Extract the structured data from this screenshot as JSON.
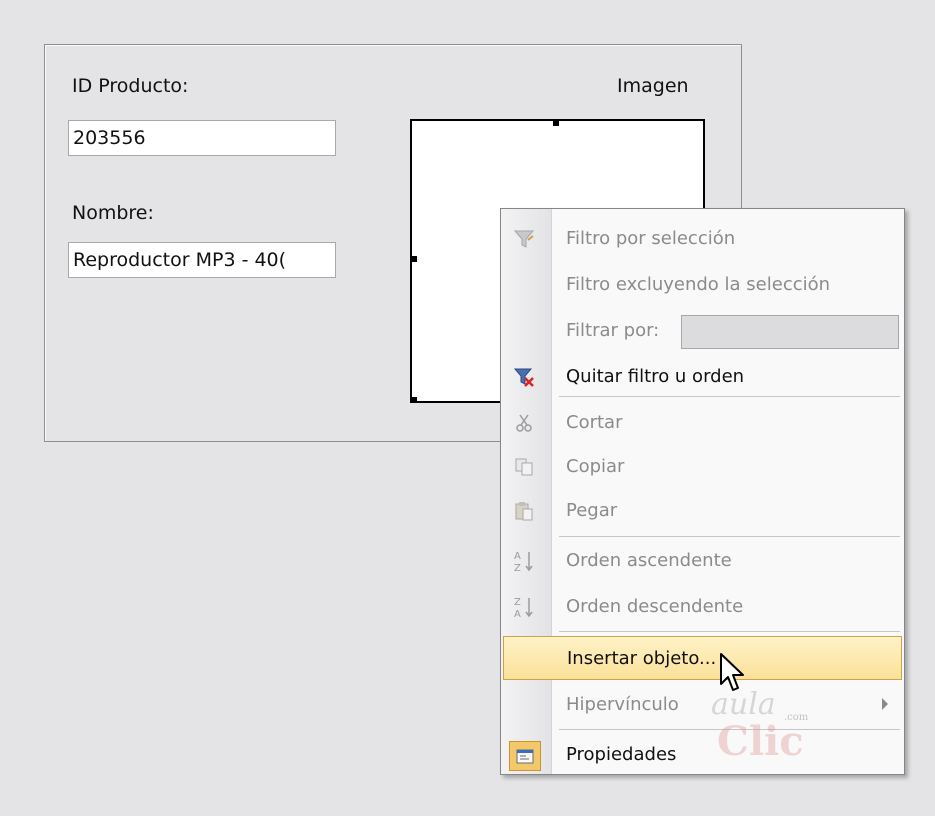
{
  "form": {
    "id_label": "ID Producto:",
    "id_value": "203556",
    "name_label": "Nombre:",
    "name_value": "Reproductor MP3 - 40(",
    "image_label": "Imagen"
  },
  "context_menu": {
    "items": [
      {
        "label": "Filtro por selección",
        "enabled": false,
        "icon": "filter-selection-icon"
      },
      {
        "label": "Filtro excluyendo la selección",
        "enabled": false,
        "icon": ""
      },
      {
        "label": "Filtrar por:",
        "enabled": false,
        "icon": "",
        "input_value": ""
      },
      {
        "label": "Quitar filtro u orden",
        "enabled": true,
        "icon": "remove-filter-icon"
      },
      {
        "label": "Cortar",
        "enabled": false,
        "icon": "scissors-icon"
      },
      {
        "label": "Copiar",
        "enabled": false,
        "icon": "copy-icon"
      },
      {
        "label": "Pegar",
        "enabled": false,
        "icon": "paste-icon"
      },
      {
        "label": "Orden ascendente",
        "enabled": false,
        "icon": "sort-ascending-icon"
      },
      {
        "label": "Orden descendente",
        "enabled": false,
        "icon": "sort-descending-icon"
      },
      {
        "label": "Insertar objeto...",
        "enabled": true,
        "highlighted": true,
        "icon": ""
      },
      {
        "label": "Hipervínculo",
        "enabled": false,
        "icon": "",
        "submenu": true
      },
      {
        "label": "Propiedades",
        "enabled": true,
        "icon": "properties-icon"
      }
    ]
  },
  "watermark": {
    "line1": "aula",
    "line2": "Clic",
    "suffix": ".com"
  }
}
